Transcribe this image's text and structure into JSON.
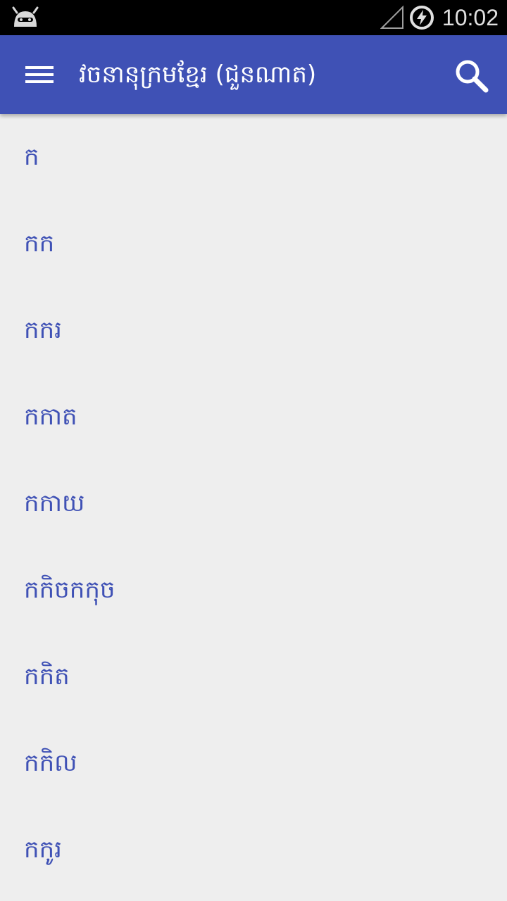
{
  "status_bar": {
    "time": "10:02",
    "icons": [
      "android-icon",
      "signal-icon",
      "battery-charging-icon"
    ]
  },
  "app_bar": {
    "title": "វចនានុក្រមខ្មែរ (ជួនណាត)",
    "menu_icon": "menu-icon",
    "search_icon": "search-icon",
    "color": "#3f51b5"
  },
  "words": [
    {
      "label": "ក"
    },
    {
      "label": "កក"
    },
    {
      "label": "កករ"
    },
    {
      "label": "កកាត"
    },
    {
      "label": "កកាយ"
    },
    {
      "label": "កកិចកកុច"
    },
    {
      "label": "កកិត"
    },
    {
      "label": "កកិល"
    },
    {
      "label": "កកូរ"
    }
  ]
}
